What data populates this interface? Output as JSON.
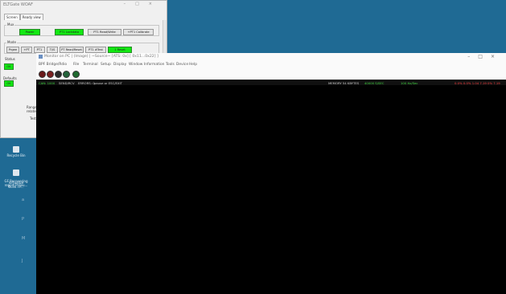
{
  "back_window": {
    "title": "ELTGate WOAF",
    "tabs": [
      "Screen",
      "Ready view"
    ],
    "groups": [
      {
        "label": "Mux"
      },
      {
        "label": "Mode"
      }
    ],
    "row1_buttons": [
      "Power",
      "PT1 Lockdata",
      "PT1 Read/Write",
      "+PT1 Calibrate"
    ],
    "row2_buttons": [
      "Prgee",
      "+PT",
      "PT1",
      "Ti/S",
      "PT Read/Reset",
      "PT1 #Test",
      "1 Reset"
    ],
    "side_labels": {
      "status": "Status",
      "ok1": "OK",
      "defaults": "Defaults",
      "ok2": "OK",
      "range_label": "Range fill\nrelated",
      "test": "Test"
    }
  },
  "desktop": {
    "icons": [
      {
        "label": "Recycle Bin"
      },
      {
        "label": "Virtualize\nBuild FP..."
      },
      {
        "label": "GF Recovering\nreport Pl (eu..."
      }
    ],
    "marks": [
      "a",
      "P",
      "M",
      "J"
    ]
  },
  "front_window": {
    "title": "Monitor on PC | (Image) | ~Source~ [ATS: 0x] [ 0x11...0x22] ]",
    "window_controls": [
      "–",
      "□",
      "×"
    ],
    "menu": [
      "BPF Bridge/Rdio",
      "File",
      "Terminal",
      "Setup",
      "Display",
      "Window",
      "Information",
      "Tools",
      "Device",
      "Help"
    ],
    "toolbar_dots": [
      {
        "name": "record",
        "color": "#6a1a1a"
      },
      {
        "name": "stop",
        "color": "#7a1f1f"
      },
      {
        "name": "play",
        "color": "#2a2a2a"
      },
      {
        "name": "step",
        "color": "#23633a"
      },
      {
        "name": "connect",
        "color": "#1f6a2f"
      }
    ],
    "status": [
      {
        "text": "CAN: 1000",
        "color": "#42d842"
      },
      {
        "text": "SEND/RCV",
        "color": "#cfcfcf"
      },
      {
        "text": "ERRORS: 0",
        "color": "#cfcfcf"
      },
      {
        "text": "pause or ESC/EXIT",
        "color": "#cfcfcf"
      },
      {
        "text": "MEMORY 54 KBYTES",
        "color": "#cfcfcf"
      },
      {
        "text": "40000 S/SEC",
        "color": "#42d842"
      },
      {
        "text": "100 Hz/Sec",
        "color": "#42d842"
      },
      {
        "text": "0.0% 0.0% 1.04 7.19 0% 7.19",
        "color": "#ff3f3f"
      }
    ]
  }
}
